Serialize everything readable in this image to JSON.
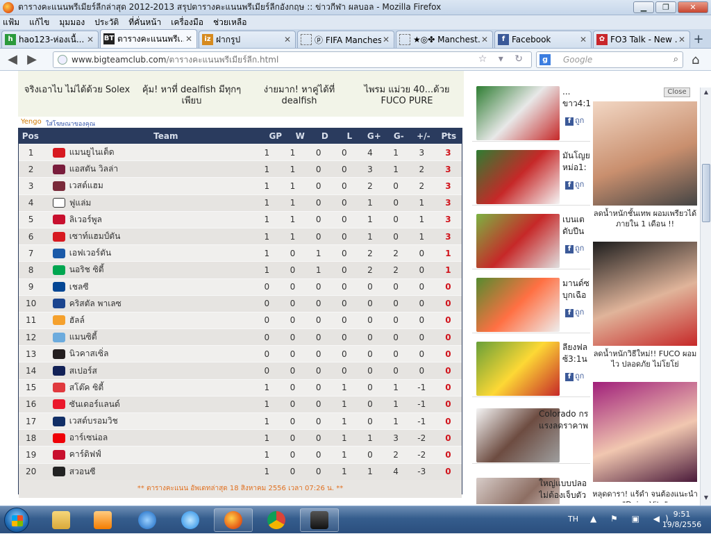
{
  "window": {
    "title": "ตารางคะแนนพรีเมียร์ลีกล่าสุด 2012-2013 สรุปตารางคะแนนพรีเมียร์ลีกอังกฤษ :: ข่าวกีฬา ผลบอล - Mozilla Firefox",
    "minimize": "▁",
    "restore": "❐",
    "close": "✕"
  },
  "menu": [
    "แฟ้ม",
    "แก้ไข",
    "มุมมอง",
    "ประวัติ",
    "ที่คั่นหน้า",
    "เครื่องมือ",
    "ช่วยเหลือ"
  ],
  "tabs": [
    {
      "label": "hao123-ห่องเนื้...",
      "icon_text": "h",
      "icon_color": "#2b9a3c"
    },
    {
      "label": "ตารางคะแนนพรีเ...",
      "icon_text": "BT",
      "icon_color": "#222222"
    },
    {
      "label": "ฝากรูป",
      "icon_text": "iz",
      "icon_color": "#d68a1e"
    },
    {
      "label": "ⓟ FIFA Manches...",
      "icon_text": "",
      "icon_color": "#cccccc"
    },
    {
      "label": "★◎✤ Manchest...",
      "icon_text": "",
      "icon_color": "#cccccc"
    },
    {
      "label": "Facebook",
      "icon_text": "f",
      "icon_color": "#3b5998"
    },
    {
      "label": "FO3 Talk - New ...",
      "icon_text": "✿",
      "icon_color": "#c8262b"
    }
  ],
  "nav": {
    "url_host": "www.bigteamclub.com",
    "url_path": "/ตารางคะแนนพรีเมียร์ลีก.html",
    "search_placeholder": "Google",
    "search_engine_letter": "g"
  },
  "ad_strip": {
    "items": [
      "จริงเอาไบ ไม่ได้ด้วย Solex",
      "คุ้ม! หาที่ dealfish มีทุกๆ\nเพียบ",
      "ง่ายมาก! หาคู่ได้ที่ dealfish",
      "ไพรม แม่วย 40...ด้วย\nFUCO PURE"
    ],
    "yengo": "Yengo",
    "yengo_sub": "ใส่โฆษณาของคุณ"
  },
  "table": {
    "headers": {
      "pos": "Pos",
      "team": "Team",
      "gp": "GP",
      "w": "W",
      "d": "D",
      "l": "L",
      "gf": "G+",
      "ga": "G-",
      "gd": "+/-",
      "pts": "Pts"
    },
    "rows": [
      {
        "pos": "1",
        "team": "แมนยูไนเต็ด",
        "crest": "#d71920",
        "gp": "1",
        "w": "1",
        "d": "0",
        "l": "0",
        "gf": "4",
        "ga": "1",
        "gd": "3",
        "pts": "3"
      },
      {
        "pos": "2",
        "team": "แอสตัน วิลล่า",
        "crest": "#7a1d3c",
        "gp": "1",
        "w": "1",
        "d": "0",
        "l": "0",
        "gf": "3",
        "ga": "1",
        "gd": "2",
        "pts": "3"
      },
      {
        "pos": "3",
        "team": "เวสต์แฮม",
        "crest": "#7a2a3a",
        "gp": "1",
        "w": "1",
        "d": "0",
        "l": "0",
        "gf": "2",
        "ga": "0",
        "gd": "2",
        "pts": "3"
      },
      {
        "pos": "4",
        "team": "ฟูแล่ม",
        "crest": "#ffffff",
        "gp": "1",
        "w": "1",
        "d": "0",
        "l": "0",
        "gf": "1",
        "ga": "0",
        "gd": "1",
        "pts": "3"
      },
      {
        "pos": "5",
        "team": "ลิเวอร์พูล",
        "crest": "#c8102e",
        "gp": "1",
        "w": "1",
        "d": "0",
        "l": "0",
        "gf": "1",
        "ga": "0",
        "gd": "1",
        "pts": "3"
      },
      {
        "pos": "6",
        "team": "เซาท์แฮมป์ตัน",
        "crest": "#d71920",
        "gp": "1",
        "w": "1",
        "d": "0",
        "l": "0",
        "gf": "1",
        "ga": "0",
        "gd": "1",
        "pts": "3"
      },
      {
        "pos": "7",
        "team": "เอฟเวอร์ตัน",
        "crest": "#1b5aa8",
        "gp": "1",
        "w": "0",
        "d": "1",
        "l": "0",
        "gf": "2",
        "ga": "2",
        "gd": "0",
        "pts": "1"
      },
      {
        "pos": "8",
        "team": "นอริช ซิตี้",
        "crest": "#00a650",
        "gp": "1",
        "w": "0",
        "d": "1",
        "l": "0",
        "gf": "2",
        "ga": "2",
        "gd": "0",
        "pts": "1"
      },
      {
        "pos": "9",
        "team": "เชลซี",
        "crest": "#034694",
        "gp": "0",
        "w": "0",
        "d": "0",
        "l": "0",
        "gf": "0",
        "ga": "0",
        "gd": "0",
        "pts": "0"
      },
      {
        "pos": "10",
        "team": "คริสตัล พาเลซ",
        "crest": "#1b458f",
        "gp": "0",
        "w": "0",
        "d": "0",
        "l": "0",
        "gf": "0",
        "ga": "0",
        "gd": "0",
        "pts": "0"
      },
      {
        "pos": "11",
        "team": "ฮัลล์",
        "crest": "#f5a12d",
        "gp": "0",
        "w": "0",
        "d": "0",
        "l": "0",
        "gf": "0",
        "ga": "0",
        "gd": "0",
        "pts": "0"
      },
      {
        "pos": "12",
        "team": "แมนซิตี้",
        "crest": "#6cabdd",
        "gp": "0",
        "w": "0",
        "d": "0",
        "l": "0",
        "gf": "0",
        "ga": "0",
        "gd": "0",
        "pts": "0"
      },
      {
        "pos": "13",
        "team": "นิวคาสเซิ่ล",
        "crest": "#241f20",
        "gp": "0",
        "w": "0",
        "d": "0",
        "l": "0",
        "gf": "0",
        "ga": "0",
        "gd": "0",
        "pts": "0"
      },
      {
        "pos": "14",
        "team": "สเปอร์ส",
        "crest": "#132257",
        "gp": "0",
        "w": "0",
        "d": "0",
        "l": "0",
        "gf": "0",
        "ga": "0",
        "gd": "0",
        "pts": "0"
      },
      {
        "pos": "15",
        "team": "สโต๊ค ซิตี้",
        "crest": "#e03a3e",
        "gp": "1",
        "w": "0",
        "d": "0",
        "l": "1",
        "gf": "0",
        "ga": "1",
        "gd": "-1",
        "pts": "0"
      },
      {
        "pos": "16",
        "team": "ซันเดอร์แลนด์",
        "crest": "#eb172b",
        "gp": "1",
        "w": "0",
        "d": "0",
        "l": "1",
        "gf": "0",
        "ga": "1",
        "gd": "-1",
        "pts": "0"
      },
      {
        "pos": "17",
        "team": "เวสต์บรอมวิช",
        "crest": "#122f67",
        "gp": "1",
        "w": "0",
        "d": "0",
        "l": "1",
        "gf": "0",
        "ga": "1",
        "gd": "-1",
        "pts": "0"
      },
      {
        "pos": "18",
        "team": "อาร์เซน่อล",
        "crest": "#ef0107",
        "gp": "1",
        "w": "0",
        "d": "0",
        "l": "1",
        "gf": "1",
        "ga": "3",
        "gd": "-2",
        "pts": "0"
      },
      {
        "pos": "19",
        "team": "คาร์ดิฟฟ์",
        "crest": "#c8102e",
        "gp": "1",
        "w": "0",
        "d": "0",
        "l": "1",
        "gf": "0",
        "ga": "2",
        "gd": "-2",
        "pts": "0"
      },
      {
        "pos": "20",
        "team": "สวอนซี",
        "crest": "#222222",
        "gp": "1",
        "w": "0",
        "d": "0",
        "l": "1",
        "gf": "1",
        "ga": "4",
        "gd": "-3",
        "pts": "0"
      }
    ],
    "updated": "** ตารางคะแนน อัพเดทล่าสุด 18 สิงหาคม 2556 เวลา 07:26 น. **"
  },
  "news": [
    {
      "text": "...\nขาว4:1",
      "fb": "ถูก",
      "colors": [
        "#2e7d32",
        "#e8e8e8",
        "#c62828"
      ]
    },
    {
      "text": "มันโญย\nหม่อ1:",
      "fb": "ถูก",
      "colors": [
        "#2e7d32",
        "#c62828",
        "#f5f5f5"
      ]
    },
    {
      "text": "เบนเต\nดับปีน",
      "fb": "ถูก",
      "colors": [
        "#7cb342",
        "#c62828",
        "#e0e0e0"
      ]
    },
    {
      "text": "มานด์ซ\nบุกเฉือ",
      "fb": "ถูก",
      "colors": [
        "#558b2f",
        "#ff7043",
        "#eeeeee"
      ]
    },
    {
      "text": "ลียงฟล\nซ้3:1น",
      "fb": "ถูก",
      "colors": [
        "#689f38",
        "#fdd835",
        "#c62828"
      ]
    },
    {
      "text": "Colorado กร\nแรงลดราคาพ",
      "fb": "",
      "colors": [
        "#f5f5f5",
        "#6d4c41",
        "#9e9e9e"
      ]
    },
    {
      "text": "ใหญ่แบบปลอ\nไม่ต้องเจ็บตัว",
      "fb": "",
      "colors": [
        "#d7ccc8",
        "#8d6e63",
        "#efebe9"
      ]
    }
  ],
  "ad_panel": {
    "close": "Close",
    "ads": [
      {
        "caption": "ลดน้ำหนักชั้นเทพ ผอมเพรียวได้ภายใน 1 เดือน !!",
        "colors": [
          "#f2d7c4",
          "#c98f6e",
          "#444444"
        ]
      },
      {
        "caption": "ลดน้ำหนักวิธีใหม่!! FUCO ผอมไว ปลอดภัย ไม่โยโย่",
        "colors": [
          "#1d1d1d",
          "#e0b49a",
          "#c62828"
        ]
      },
      {
        "caption": "หลุดดารา! แร้ดำ จนต้องแนะนำ \"Daisy Vita\"",
        "colors": [
          "#a01f7a",
          "#f1c7b0",
          "#4a1a3a"
        ]
      }
    ]
  },
  "taskbar": {
    "lang": "TH",
    "time": "9:51",
    "date": "19/8/2556",
    "tray_icons": "▲ ⚑ ▣ ◀)"
  }
}
